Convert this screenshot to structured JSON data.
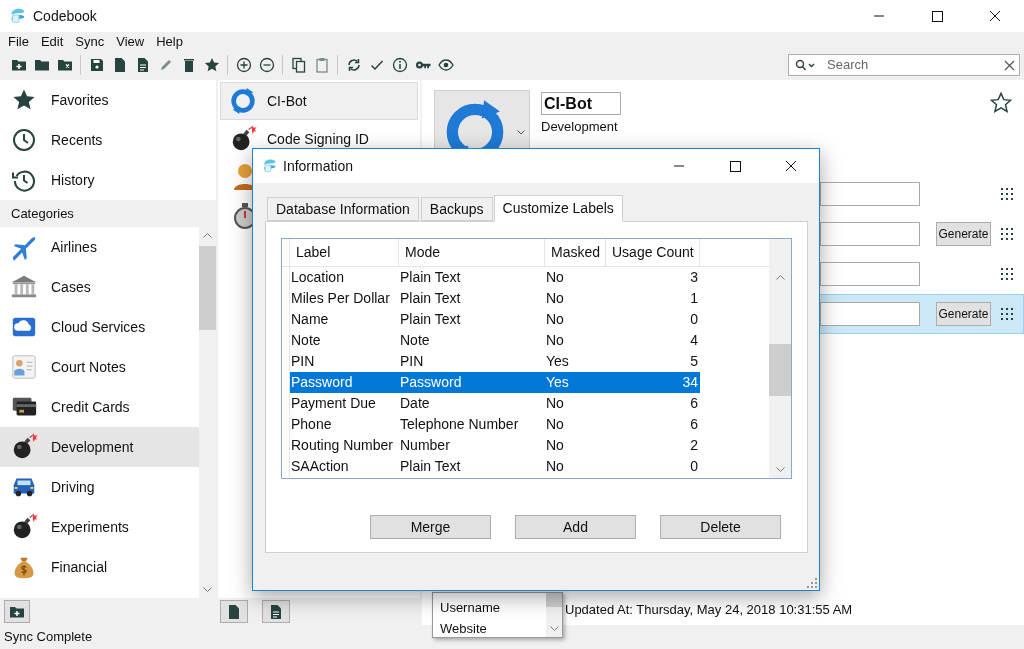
{
  "window": {
    "title": "Codebook"
  },
  "menu": [
    "File",
    "Edit",
    "Sync",
    "View",
    "Help"
  ],
  "search": {
    "placeholder": "Search"
  },
  "sidebar": {
    "items": [
      {
        "label": "Favorites"
      },
      {
        "label": "Recents"
      },
      {
        "label": "History"
      }
    ],
    "categories_header": "Categories",
    "categories": [
      {
        "label": "Airlines",
        "selected": false
      },
      {
        "label": "Cases",
        "selected": false
      },
      {
        "label": "Cloud Services",
        "selected": false
      },
      {
        "label": "Court Notes",
        "selected": false
      },
      {
        "label": "Credit Cards",
        "selected": false
      },
      {
        "label": "Development",
        "selected": true
      },
      {
        "label": "Driving",
        "selected": false
      },
      {
        "label": "Experiments",
        "selected": false
      },
      {
        "label": "Financial",
        "selected": false
      }
    ]
  },
  "entries": [
    {
      "label": "CI-Bot",
      "selected": true
    },
    {
      "label": "Code Signing ID",
      "selected": false
    }
  ],
  "detail": {
    "name": "CI-Bot",
    "category": "Development",
    "fields": [
      {
        "selected": false
      },
      {
        "selected": false,
        "button": "Generate"
      },
      {
        "selected": false
      },
      {
        "selected": true,
        "button": "Generate"
      }
    ],
    "label_dropdown": [
      "Username",
      "Website"
    ],
    "updated_at": "Updated At: Thursday, May 24, 2018 10:31:55 AM"
  },
  "dialog": {
    "title": "Information",
    "tabs": [
      {
        "label": "Database Information",
        "selected": false
      },
      {
        "label": "Backups",
        "selected": false
      },
      {
        "label": "Customize Labels",
        "selected": true
      }
    ],
    "table": {
      "columns": [
        "Label",
        "Mode",
        "Masked",
        "Usage Count"
      ],
      "rows": [
        {
          "cells": [
            "Location",
            "Plain Text",
            "No",
            "3"
          ],
          "selected": false
        },
        {
          "cells": [
            "Miles Per Dollar",
            "Plain Text",
            "No",
            "1"
          ],
          "selected": false
        },
        {
          "cells": [
            "Name",
            "Plain Text",
            "No",
            "0"
          ],
          "selected": false
        },
        {
          "cells": [
            "Note",
            "Note",
            "No",
            "4"
          ],
          "selected": false
        },
        {
          "cells": [
            "PIN",
            "PIN",
            "Yes",
            "5"
          ],
          "selected": false
        },
        {
          "cells": [
            "Password",
            "Password",
            "Yes",
            "34"
          ],
          "selected": true
        },
        {
          "cells": [
            "Payment Due",
            "Date",
            "No",
            "6"
          ],
          "selected": false
        },
        {
          "cells": [
            "Phone",
            "Telephone Number",
            "No",
            "6"
          ],
          "selected": false
        },
        {
          "cells": [
            "Routing Number",
            "Number",
            "No",
            "2"
          ],
          "selected": false
        },
        {
          "cells": [
            "SAAction",
            "Plain Text",
            "No",
            "0"
          ],
          "selected": false
        }
      ]
    },
    "buttons": [
      "Merge",
      "Add",
      "Delete"
    ]
  },
  "status_bar": "Sync Complete"
}
